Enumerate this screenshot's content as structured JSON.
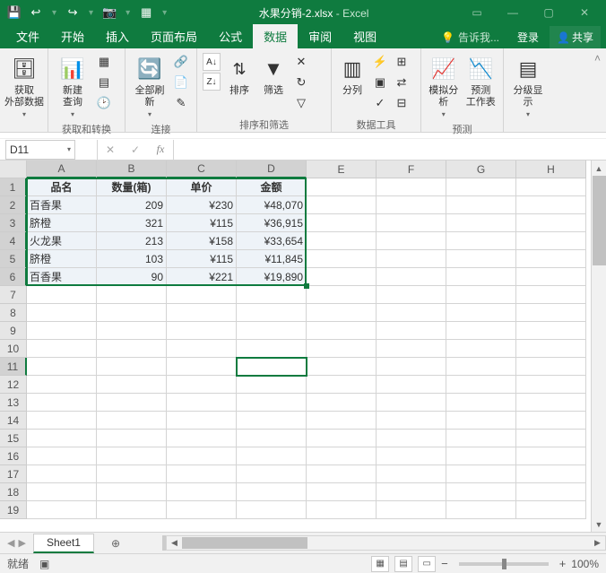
{
  "titlebar": {
    "filename": "水果分销-2.xlsx",
    "appname": "Excel"
  },
  "tabs": {
    "file": "文件",
    "home": "开始",
    "insert": "插入",
    "layout": "页面布局",
    "formulas": "公式",
    "data": "数据",
    "review": "审阅",
    "view": "视图",
    "tellme": "告诉我...",
    "login": "登录",
    "share": "共享"
  },
  "ribbon": {
    "get_external": "获取\n外部数据",
    "new_query": "新建\n查询",
    "refresh_all": "全部刷新",
    "sort": "排序",
    "filter": "筛选",
    "split_col": "分列",
    "whatif": "模拟分析",
    "forecast": "预测\n工作表",
    "outline": "分级显示",
    "grp_get_transform": "获取和转换",
    "grp_connections": "连接",
    "grp_sort_filter": "排序和筛选",
    "grp_data_tools": "数据工具",
    "grp_forecast": "预测"
  },
  "namebox": "D11",
  "columns": [
    "A",
    "B",
    "C",
    "D",
    "E",
    "F",
    "G",
    "H"
  ],
  "rows": [
    1,
    2,
    3,
    4,
    5,
    6,
    7,
    8,
    9,
    10,
    11,
    12,
    13,
    14,
    15,
    16,
    17,
    18,
    19
  ],
  "chart_data": {
    "type": "table",
    "header": {
      "A": "品名",
      "B": "数量(箱)",
      "C": "单价",
      "D": "金额"
    },
    "rows": [
      {
        "A": "百香果",
        "B": "209",
        "C": "¥230",
        "D": "¥48,070"
      },
      {
        "A": "脐橙",
        "B": "321",
        "C": "¥115",
        "D": "¥36,915"
      },
      {
        "A": "火龙果",
        "B": "213",
        "C": "¥158",
        "D": "¥33,654"
      },
      {
        "A": "脐橙",
        "B": "103",
        "C": "¥115",
        "D": "¥11,845"
      },
      {
        "A": "百香果",
        "B": "90",
        "C": "¥221",
        "D": "¥19,890"
      }
    ]
  },
  "sheet_tab": "Sheet1",
  "status": {
    "ready": "就绪",
    "zoom": "100%"
  }
}
